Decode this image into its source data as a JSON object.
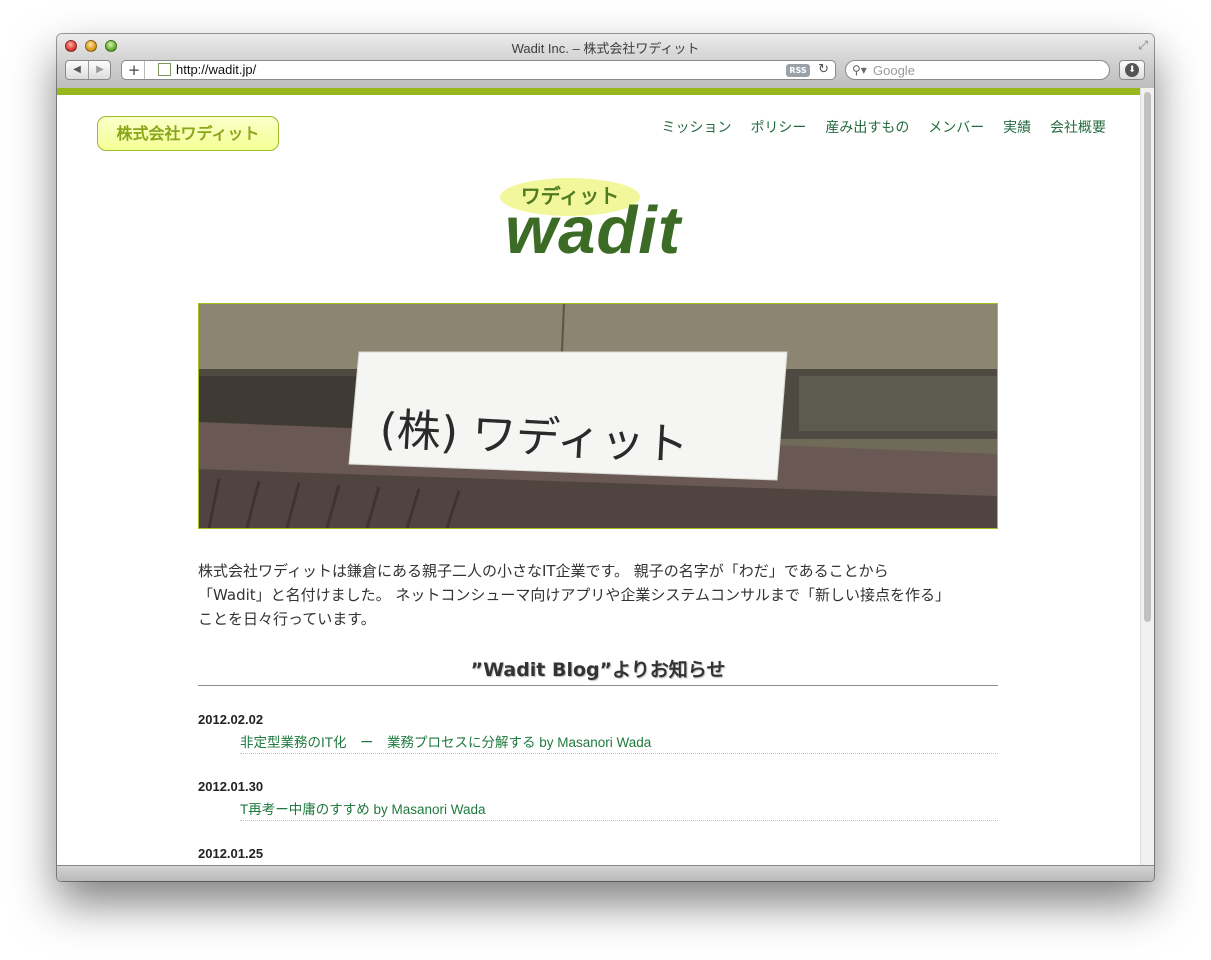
{
  "window": {
    "title": "Wadit Inc. – 株式会社ワディット",
    "url": "http://wadit.jp/",
    "rss_label": "RSS",
    "search_placeholder": "Google",
    "add_tab_glyph": "+",
    "back_glyph": "◀",
    "forward_glyph": "▶",
    "reload_glyph": "↻",
    "fullscreen_glyph": "⤢",
    "search_glyph": "⚲▾",
    "download_glyph": "⬇"
  },
  "header": {
    "brand": "株式会社ワディット",
    "nav": [
      "ミッション",
      "ポリシー",
      "産み出すもの",
      "メンバー",
      "実績",
      "会社概要"
    ]
  },
  "logo": {
    "kana": "ワディット",
    "word": "wadit"
  },
  "hero": {
    "sign_text": "(株) ワディット"
  },
  "intro": {
    "line1": "株式会社ワディットは鎌倉にある親子二人の小さなIT企業です。 親子の名字が「わだ」であることから",
    "line2": "「Wadit」と名付けました。 ネットコンシューマ向けアプリや企業システムコンサルまで「新しい接点を作る」",
    "line3": "ことを日々行っています。"
  },
  "blog": {
    "title": "”Wadit Blog”よりお知らせ",
    "posts": [
      {
        "date": "2012.02.02",
        "title": "非定型業務のIT化　ー　業務プロセスに分解する by Masanori Wada"
      },
      {
        "date": "2012.01.30",
        "title": "T再考ー中庸のすすめ by Masanori Wada"
      },
      {
        "date": "2012.01.25",
        "title": ""
      }
    ]
  },
  "colors": {
    "accent": "#99b81d",
    "link": "#246b40",
    "logo_green": "#3b6b24"
  }
}
